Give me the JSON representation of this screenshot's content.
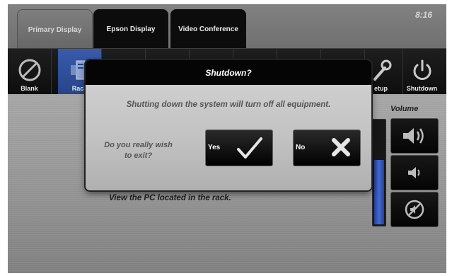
{
  "tabs": [
    {
      "label": "Primary Display",
      "active": true
    },
    {
      "label": "Epson Display",
      "active": false
    },
    {
      "label": "Video Conference",
      "active": false
    }
  ],
  "clock": "8:16",
  "sources": {
    "blank": "Blank",
    "rack": "Rack",
    "setup": "etup",
    "shutdown": "Shutdown"
  },
  "main": {
    "description": "View the PC located in the rack."
  },
  "volume": {
    "label": "Volume",
    "level_fraction": 0.62,
    "buttons": [
      "volume-up-icon",
      "volume-down-icon",
      "mute-icon"
    ]
  },
  "dialog": {
    "title": "Shutdown?",
    "message": "Shutting down the system will turn off all equipment.",
    "question_line1": "Do you really wish",
    "question_line2": "to exit?",
    "yes_label": "Yes",
    "no_label": "No"
  },
  "colors": {
    "accent": "#3e63b9",
    "volume_fill": "#4a73e0"
  }
}
